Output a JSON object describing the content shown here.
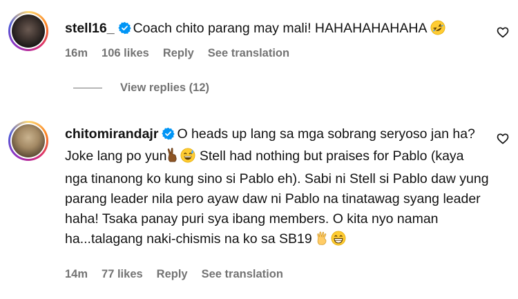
{
  "comments": [
    {
      "username": "stell16_",
      "text": "Coach chito parang may mali! HAHAHAHAHAHA",
      "emoji_end": "rolling-on-floor-laughing",
      "time": "16m",
      "likes": "106 likes",
      "reply": "Reply",
      "translate": "See translation",
      "view_replies": "View replies (12)"
    },
    {
      "username": "chitomirandajr",
      "text_part1": "O heads up lang sa mga sobrang seryoso jan ha? Joke lang po yun",
      "text_part2": " Stell had nothing but praises for Pablo (kaya nga tinanong ko kung sino si Pablo eh). Sabi ni Stell si Pablo daw yung parang leader nila pero ayaw daw ni Pablo na tinatawag syang leader haha! Tsaka panay puri sya ibang members. O kita nyo naman ha...talagang naki-chismis na ko sa SB19 ",
      "time": "14m",
      "likes": "77 likes",
      "reply": "Reply",
      "translate": "See translation"
    }
  ],
  "colors": {
    "verified": "#0095f6",
    "meta": "#737373",
    "text": "#111111"
  },
  "icons": [
    "verified-badge-icon",
    "heart-icon",
    "emoji-icon"
  ]
}
